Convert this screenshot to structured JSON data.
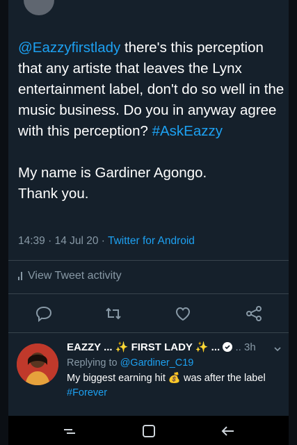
{
  "tweet": {
    "mention": "@Eazzyfirstlady",
    "body": " there's this perception that any artiste that leaves the Lynx entertainment label, don't do so well in the music business. Do you in anyway agree with this perception? ",
    "hashtag": "#AskEazzy",
    "closing_line1": "My name is Gardiner Agongo.",
    "closing_line2": "Thank you.",
    "time": "14:39",
    "date": "14 Jul 20",
    "source": "Twitter for Android",
    "activity_label": "View Tweet activity"
  },
  "actions": {
    "icons": [
      "reply-icon",
      "retweet-icon",
      "like-icon",
      "share-icon"
    ]
  },
  "reply": {
    "author": "EAZZY ... ✨ FIRST LADY ✨ ...",
    "time": "3h",
    "replying_prefix": "Replying to ",
    "replying_handle": "@Gardiner_C19",
    "text_part1": "My biggest earning hit ",
    "money_emoji": "💰",
    "text_part2": " was after the label ",
    "hashtag": "#Forever"
  },
  "colors": {
    "background": "#15202b",
    "text": "#ffffff",
    "muted": "#8899a6",
    "accent": "#1da1f2",
    "divider": "#38444d"
  }
}
